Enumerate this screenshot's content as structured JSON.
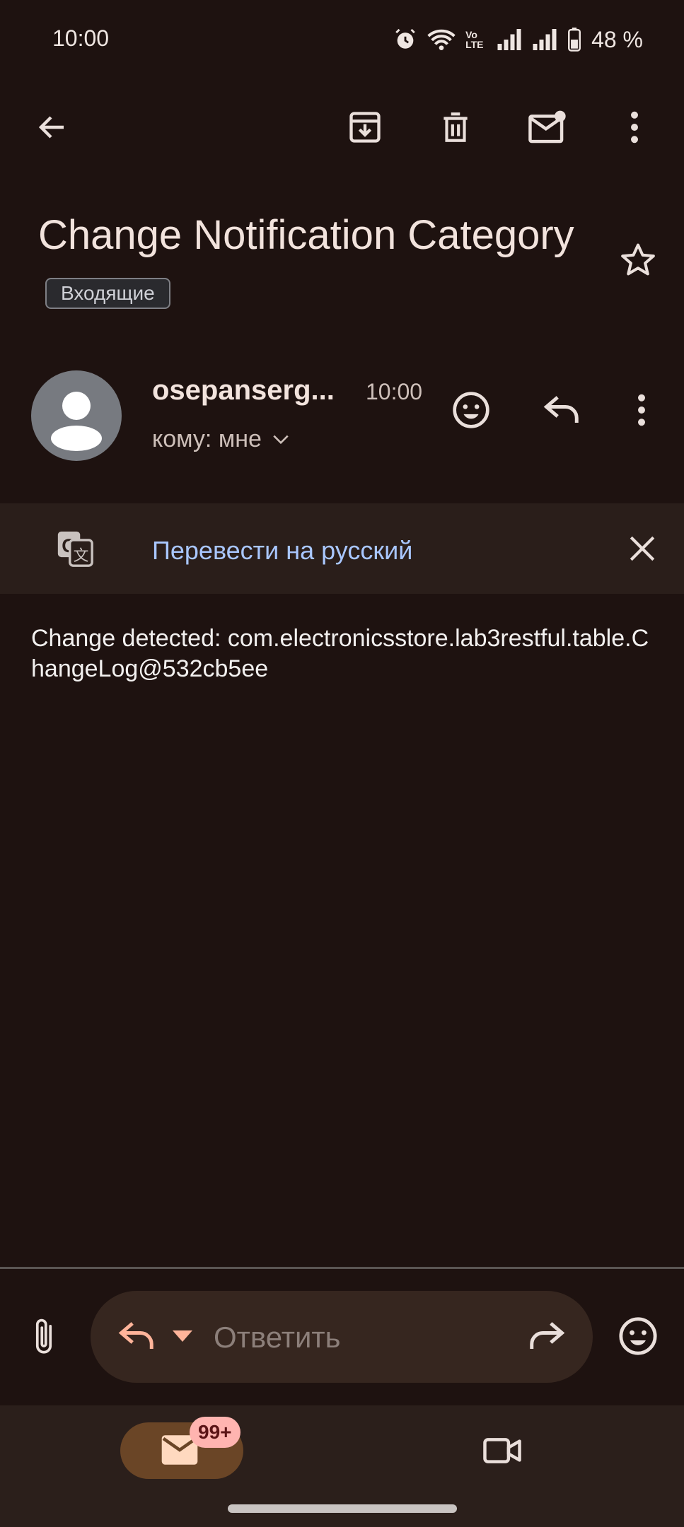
{
  "status_bar": {
    "time": "10:00",
    "volte": "Vo LTE",
    "battery": "48 %"
  },
  "toolbar": {
    "icons": [
      "back-arrow-icon",
      "archive-icon",
      "delete-icon",
      "mark-unread-icon",
      "more-vert-icon"
    ]
  },
  "email": {
    "subject": "Change Notification Category",
    "label": "Входящие",
    "sender": "osepanserg...",
    "time": "10:00",
    "recipient": "кому: мне",
    "body": "Change detected: com.electronicsstore.lab3restful.table.ChangeLog@532cb5ee"
  },
  "translate": {
    "label": "Перевести на русский"
  },
  "reply": {
    "placeholder": "Ответить"
  },
  "nav": {
    "badge": "99+"
  },
  "colors": {
    "background": "#1e1210",
    "accent_link": "#a9c7ff",
    "mail_pill": "#6a4526",
    "badge": "#ffb4b0"
  }
}
